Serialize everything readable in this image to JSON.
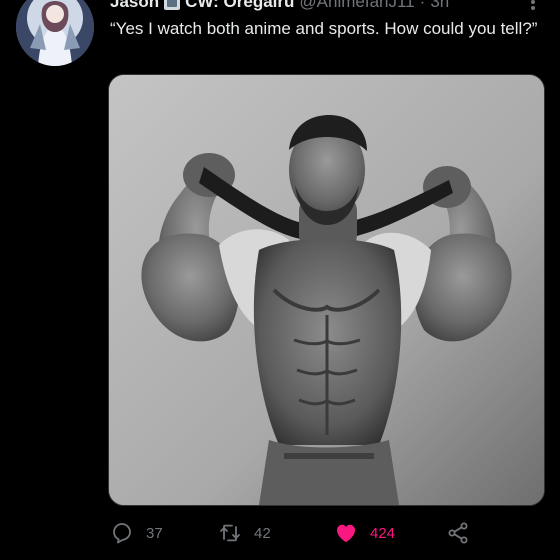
{
  "author": {
    "display_name": "Jason",
    "display_name_suffix": "CW: Oregairu",
    "handle": "@AnimefanJ11",
    "separator": "·",
    "time": "3h"
  },
  "tweet": {
    "text": "“Yes I watch both anime and sports. How could you tell?”"
  },
  "actions": {
    "reply_count": "37",
    "retweet_count": "42",
    "like_count": "424"
  },
  "colors": {
    "background": "#000000",
    "text_primary": "#e7e9ea",
    "text_secondary": "#71767b",
    "like_active": "#f91880"
  },
  "icons": {
    "reply": "reply-icon",
    "retweet": "retweet-icon",
    "like": "heart-icon",
    "share": "share-icon",
    "more": "more-icon",
    "badge": "card-badge-icon"
  }
}
